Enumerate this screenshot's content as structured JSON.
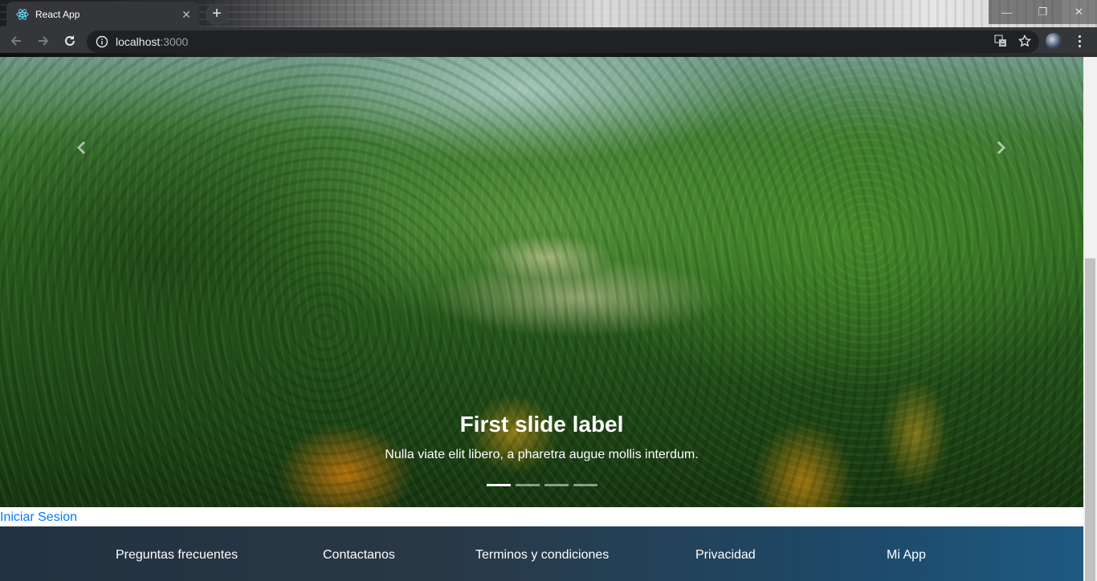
{
  "browser": {
    "tab_title": "React App",
    "tab_close": "✕",
    "new_tab": "+",
    "url_host": "localhost",
    "url_port": ":3000",
    "window_controls": {
      "minimize": "—",
      "restore": "❐",
      "close": "✕"
    }
  },
  "carousel": {
    "caption_title": "First slide label",
    "caption_text": "Nulla viate elit libero, a pharetra augue mollis interdum.",
    "indicator_count": 4,
    "active_index": 0
  },
  "login_link": "Iniciar Sesion",
  "footer": {
    "links": [
      "Preguntas frecuentes",
      "Contactanos",
      "Terminos y condiciones",
      "Privacidad",
      "Mi App"
    ]
  },
  "colors": {
    "link": "#007bff",
    "browser_toolbar": "#35363a",
    "footer_start": "#223240",
    "footer_end": "#1e5a82"
  }
}
